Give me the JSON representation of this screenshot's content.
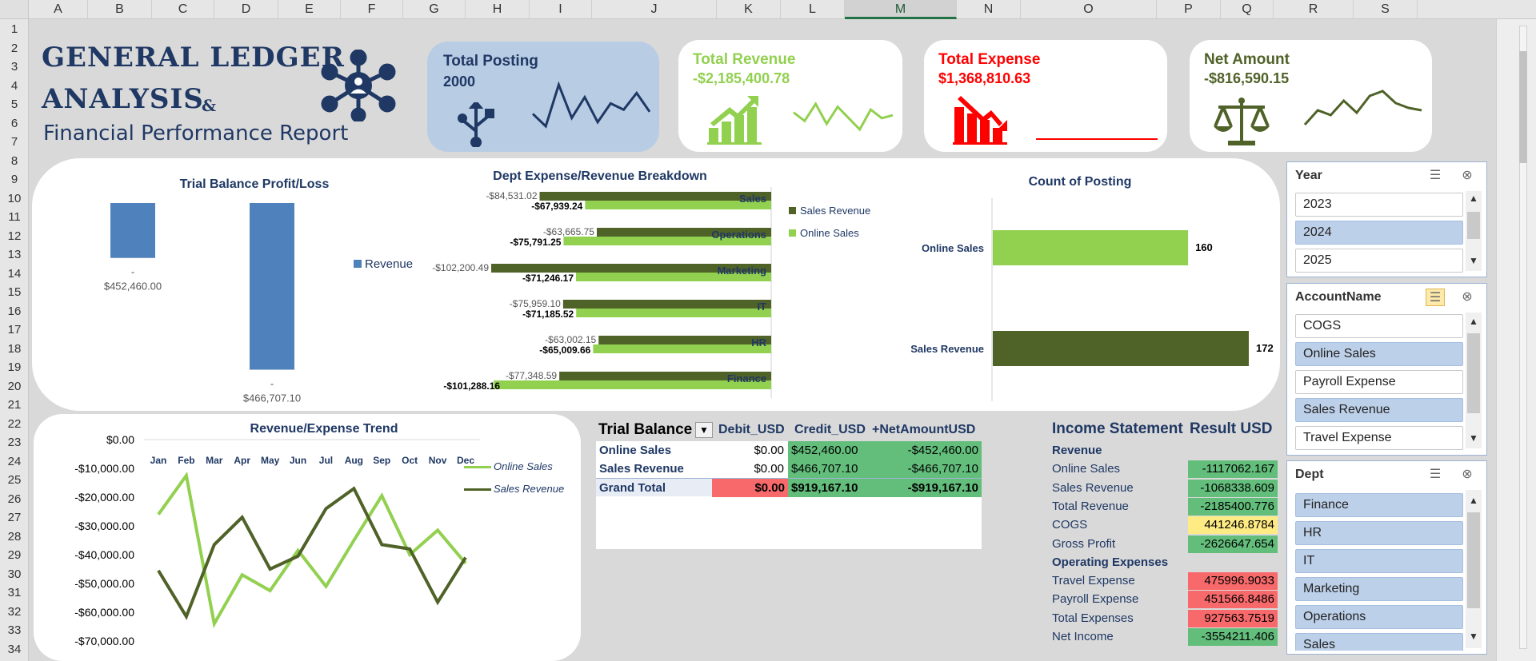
{
  "columns": [
    "A",
    "B",
    "C",
    "D",
    "E",
    "F",
    "G",
    "H",
    "I",
    "J",
    "K",
    "L",
    "M",
    "N",
    "O",
    "P",
    "Q",
    "R",
    "S"
  ],
  "rows": [
    "1",
    "2",
    "3",
    "4",
    "5",
    "6",
    "7",
    "8",
    "9",
    "10",
    "11",
    "12",
    "13",
    "14",
    "15",
    "16",
    "17",
    "18",
    "19",
    "20",
    "21",
    "22",
    "23",
    "24",
    "25",
    "26",
    "27",
    "28",
    "29",
    "30",
    "31",
    "32",
    "33",
    "34"
  ],
  "title": {
    "line1": "GENERAL LEDGER",
    "line2": "ANALYSIS",
    "amp": "&",
    "line3": "Financial Performance Report",
    "icon": "network-hub-icon"
  },
  "kpis": {
    "posting": {
      "title": "Total Posting",
      "value": "2000",
      "icon": "usb-icon",
      "sparkline": [
        10,
        4,
        24,
        8,
        18,
        6,
        15,
        12,
        20,
        11
      ],
      "color": "#1f3864"
    },
    "revenue": {
      "title": "Total Revenue",
      "value": "-$2,185,400.78",
      "icon": "growth-chart-icon",
      "sparkline": [
        12,
        9,
        15,
        8,
        14,
        10,
        6,
        13,
        10,
        11
      ],
      "color": "#92d050"
    },
    "expense": {
      "title": "Total Expense",
      "value": "$1,368,810.63",
      "icon": "decline-chart-icon",
      "sparkline": [
        5,
        5,
        5,
        5,
        5,
        5,
        5,
        5,
        5,
        5
      ],
      "color": "#ff0000"
    },
    "net": {
      "title": "Net Amount",
      "value": "-$816,590.15",
      "icon": "scales-icon",
      "sparkline": [
        8,
        14,
        12,
        18,
        13,
        20,
        22,
        17,
        15,
        14
      ],
      "color": "#4f6228"
    }
  },
  "charts": {
    "trial": {
      "title": "Trial Balance Profit/Loss",
      "legend": "Revenue",
      "bars": [
        {
          "value": -452460.0,
          "label": "-",
          "valueText": "$452,460.00"
        },
        {
          "value": -466707.1,
          "label": "-",
          "valueText": "$466,707.10"
        }
      ]
    },
    "dept": {
      "title": "Dept Expense/Revenue Breakdown",
      "legend": [
        "Sales Revenue",
        "Online Sales"
      ],
      "categories": [
        "Sales",
        "Operations",
        "Marketing",
        "IT",
        "HR",
        "Finance"
      ],
      "sales_revenue": [
        -84531.02,
        -63665.75,
        -102200.49,
        -75959.1,
        -63002.15,
        -77348.59
      ],
      "online_sales": [
        -67939.24,
        -75791.25,
        -71246.17,
        -71185.52,
        -65009.66,
        -101288.16
      ],
      "sales_revenue_labels": [
        "-$84,531.02",
        "-$63,665.75",
        "-$102,200.49",
        "-$75,959.10",
        "-$63,002.15",
        "-$77,348.59"
      ],
      "online_sales_labels": [
        "-$67,939.24",
        "-$75,791.25",
        "-$71,246.17",
        "-$71,185.52",
        "-$65,009.66",
        "-$101,288.16"
      ]
    },
    "count": {
      "title": "Count of Posting",
      "categories": [
        "Online Sales",
        "Sales Revenue"
      ],
      "values": [
        160,
        172
      ]
    },
    "trend": {
      "title": "Revenue/Expense Trend",
      "months": [
        "Jan",
        "Feb",
        "Mar",
        "Apr",
        "May",
        "Jun",
        "Jul",
        "Aug",
        "Sep",
        "Oct",
        "Nov",
        "Dec"
      ],
      "yticks": [
        "$0.00",
        "-$10,000.00",
        "-$20,000.00",
        "-$30,000.00",
        "-$40,000.00",
        "-$50,000.00",
        "-$60,000.00",
        "-$70,000.00"
      ],
      "legend": [
        "Online Sales",
        "Sales Revenue"
      ]
    }
  },
  "chart_data": [
    {
      "type": "bar",
      "title": "Trial Balance Profit/Loss",
      "categories": [
        "Online Sales",
        "Sales Revenue"
      ],
      "series": [
        {
          "name": "Revenue",
          "values": [
            -452460.0,
            -466707.1
          ]
        }
      ]
    },
    {
      "type": "bar",
      "title": "Dept Expense/Revenue Breakdown",
      "categories": [
        "Sales",
        "Operations",
        "Marketing",
        "IT",
        "HR",
        "Finance"
      ],
      "series": [
        {
          "name": "Sales Revenue",
          "values": [
            -84531.02,
            -63665.75,
            -102200.49,
            -75959.1,
            -63002.15,
            -77348.59
          ]
        },
        {
          "name": "Online Sales",
          "values": [
            -67939.24,
            -75791.25,
            -71246.17,
            -71185.52,
            -65009.66,
            -101288.16
          ]
        }
      ]
    },
    {
      "type": "bar",
      "title": "Count of Posting",
      "categories": [
        "Online Sales",
        "Sales Revenue"
      ],
      "values": [
        160,
        172
      ]
    },
    {
      "type": "line",
      "title": "Revenue/Expense Trend",
      "x": [
        "Jan",
        "Feb",
        "Mar",
        "Apr",
        "May",
        "Jun",
        "Jul",
        "Aug",
        "Sep",
        "Oct",
        "Nov",
        "Dec"
      ],
      "ylim": [
        -70000,
        0
      ],
      "series": [
        {
          "name": "Online Sales",
          "values": [
            -26000,
            -12500,
            -64000,
            -47000,
            -52500,
            -38500,
            -51000,
            -35000,
            -19500,
            -40000,
            -31500,
            -43000
          ]
        },
        {
          "name": "Sales Revenue",
          "values": [
            -45500,
            -61500,
            -36500,
            -27000,
            -45000,
            -40500,
            -24000,
            -17000,
            -36500,
            -38000,
            -56500,
            -41000
          ]
        }
      ]
    }
  ],
  "pivot": {
    "title": "Trial Balance",
    "filter_icon": "filter-icon",
    "headers": [
      "Debit_USD",
      "Credit_USD",
      "+NetAmountUSD"
    ],
    "rows": [
      {
        "label": "Online Sales",
        "debit": "$0.00",
        "credit": "$452,460.00",
        "net": "-$452,460.00"
      },
      {
        "label": "Sales Revenue",
        "debit": "$0.00",
        "credit": "$466,707.10",
        "net": "-$466,707.10"
      }
    ],
    "total": {
      "label": "Grand Total",
      "debit": "$0.00",
      "credit": "$919,167.10",
      "net": "-$919,167.10"
    }
  },
  "income": {
    "header_left": "Income Statement",
    "header_right": "Result USD",
    "lines": [
      {
        "label": "Revenue",
        "value": "",
        "bold": true,
        "color": ""
      },
      {
        "label": "Online Sales",
        "value": "-1117062.167",
        "bold": false,
        "color": "#63be7b"
      },
      {
        "label": "Sales Revenue",
        "value": "-1068338.609",
        "bold": false,
        "color": "#63be7b"
      },
      {
        "label": "Total Revenue",
        "value": "-2185400.776",
        "bold": false,
        "color": "#63be7b"
      },
      {
        "label": "COGS",
        "value": "441246.8784",
        "bold": false,
        "color": "#ffeb84"
      },
      {
        "label": "Gross Profit",
        "value": "-2626647.654",
        "bold": false,
        "color": "#63be7b"
      },
      {
        "label": "Operating Expenses",
        "value": "",
        "bold": true,
        "color": ""
      },
      {
        "label": "Travel Expense",
        "value": "475996.9033",
        "bold": false,
        "color": "#f8696b"
      },
      {
        "label": "Payroll Expense",
        "value": "451566.8486",
        "bold": false,
        "color": "#f8696b"
      },
      {
        "label": "Total Expenses",
        "value": "927563.7519",
        "bold": false,
        "color": "#f8696b"
      },
      {
        "label": "Net Income",
        "value": "-3554211.406",
        "bold": false,
        "color": "#63be7b"
      }
    ]
  },
  "slicers": {
    "year": {
      "title": "Year",
      "items": [
        {
          "label": "2023",
          "on": false
        },
        {
          "label": "2024",
          "on": true
        },
        {
          "label": "2025",
          "on": false
        }
      ]
    },
    "account": {
      "title": "AccountName",
      "items": [
        {
          "label": "COGS",
          "on": false
        },
        {
          "label": "Online Sales",
          "on": true
        },
        {
          "label": "Payroll Expense",
          "on": false
        },
        {
          "label": "Sales Revenue",
          "on": true
        },
        {
          "label": "Travel Expense",
          "on": false
        }
      ]
    },
    "dept": {
      "title": "Dept",
      "items": [
        {
          "label": "Finance",
          "on": true
        },
        {
          "label": "HR",
          "on": true
        },
        {
          "label": "IT",
          "on": true
        },
        {
          "label": "Marketing",
          "on": true
        },
        {
          "label": "Operations",
          "on": true
        },
        {
          "label": "Sales",
          "on": true
        }
      ]
    }
  },
  "colors": {
    "navy": "#1f3864",
    "blue_bar": "#4f81bd",
    "dark_green": "#4f6228",
    "light_green": "#92d050",
    "red": "#ff0000"
  }
}
